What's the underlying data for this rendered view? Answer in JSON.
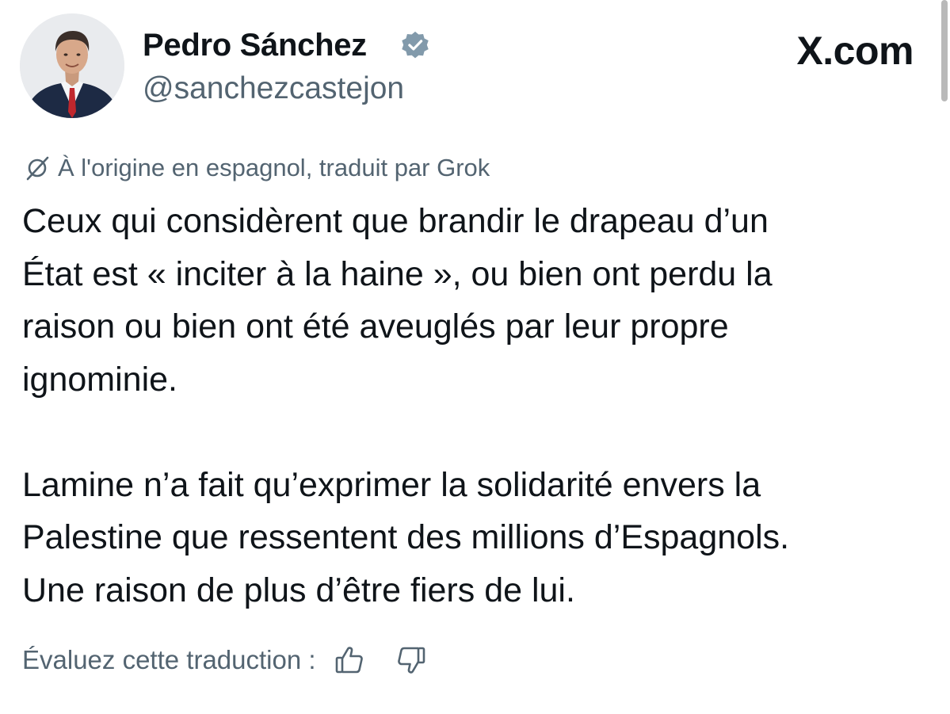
{
  "tweet": {
    "author_name": "Pedro Sánchez",
    "handle": "@sanchezcastejon",
    "site_logo": "X.com",
    "translation_note": "À l'origine en espagnol, traduit par Grok",
    "body": {
      "p1": [
        "Ceux qui considèrent que brandir le drapeau d’un",
        "État est « inciter à la haine », ou bien ont perdu la",
        "raison ou bien ont été aveuglés par leur propre",
        "ignominie."
      ],
      "p2": [
        "Lamine n’a fait qu’exprimer la solidarité envers la",
        "Palestine que ressentent des millions d’Espagnols.",
        "Une raison de plus d’être fiers de lui."
      ]
    },
    "rate_label": "Évaluez cette traduction :"
  },
  "icons": {
    "verified": "verified-badge-icon",
    "translate": "translate-icon",
    "thumbs_up": "thumbs-up-icon",
    "thumbs_down": "thumbs-down-icon"
  },
  "colors": {
    "text_primary": "#0f1419",
    "text_secondary": "#536471",
    "verified_badge": "#829aab",
    "background": "#ffffff"
  }
}
